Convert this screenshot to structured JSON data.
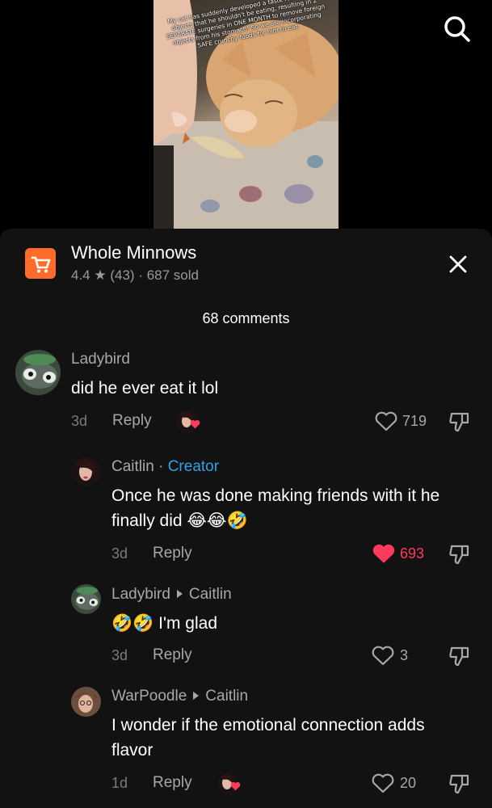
{
  "video": {
    "overlay_text": "My cat has suddenly developed a taste for crunchy objects that he shouldn't be eating, resulting in 2 SEPARATE surgeries in ONE MONTH to remove foreign objects from his stomach! So we are incorporating SAFE crunchy foods for him to eat."
  },
  "product": {
    "title": "Whole Minnows",
    "rating": "4.4",
    "star": "★",
    "reviews": "(43)",
    "sold": "· 687 sold"
  },
  "comments_header": "68 comments",
  "comments": [
    {
      "user": "Ladybird",
      "text": "did he ever eat it lol",
      "time": "3d",
      "reply": "Reply",
      "likes": "719"
    },
    {
      "user": "Caitlin",
      "badge": "Creator",
      "text": "Once he was done making friends with it he finally did 😂😂🤣",
      "time": "3d",
      "reply": "Reply",
      "likes": "693"
    },
    {
      "user": "Ladybird",
      "reply_to": "Caitlin",
      "text": "🤣🤣 I'm glad",
      "time": "3d",
      "reply": "Reply",
      "likes": "3"
    },
    {
      "user": "WarPoodle",
      "reply_to": "Caitlin",
      "text": "I wonder if the emotional connection adds flavor",
      "time": "1d",
      "reply": "Reply",
      "likes": "20"
    }
  ],
  "colors": {
    "accent_red": "#ff3b5c",
    "creator_blue": "#2fa3e6",
    "shop_orange": "#ff6b2b",
    "sheet_bg": "#121212"
  },
  "icons": [
    "search-icon",
    "shopping-cart-icon",
    "close-icon",
    "heart-icon",
    "dislike-icon"
  ]
}
